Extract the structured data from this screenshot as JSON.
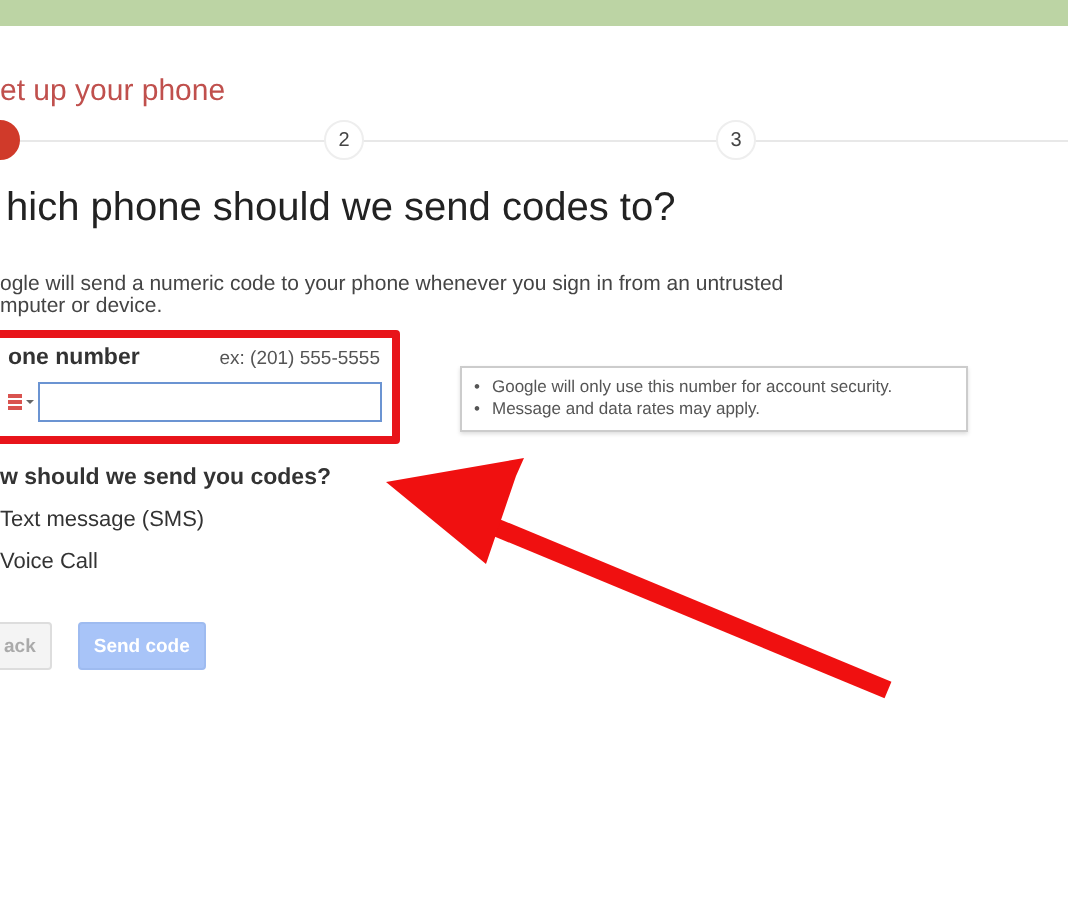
{
  "header_bar": {
    "kind": "bar"
  },
  "title": "et up your phone",
  "steps": [
    {
      "current": true
    },
    {
      "label": "2",
      "current": false
    },
    {
      "label": "3",
      "current": false
    }
  ],
  "heading": "hich phone should we send codes to?",
  "description": "ogle will send a numeric code to your phone whenever you sign in from an untrusted mputer or device.",
  "phone": {
    "label": "one number",
    "example": "ex: (201) 555-5555",
    "focused": true
  },
  "tooltip": [
    {
      "bullet": "•",
      "text": "Google will only use this number for account security."
    },
    {
      "bullet": "•",
      "text": "Message and data rates may apply."
    }
  ],
  "method_question": "w should we send you codes?",
  "methods": [
    {
      "label": "Text message (SMS)"
    },
    {
      "label": "Voice Call"
    }
  ],
  "buttons": [
    {
      "label": "ack",
      "kind": "secondary",
      "disabled": true
    },
    {
      "label": "Send code",
      "kind": "primary",
      "disabled": true
    }
  ]
}
